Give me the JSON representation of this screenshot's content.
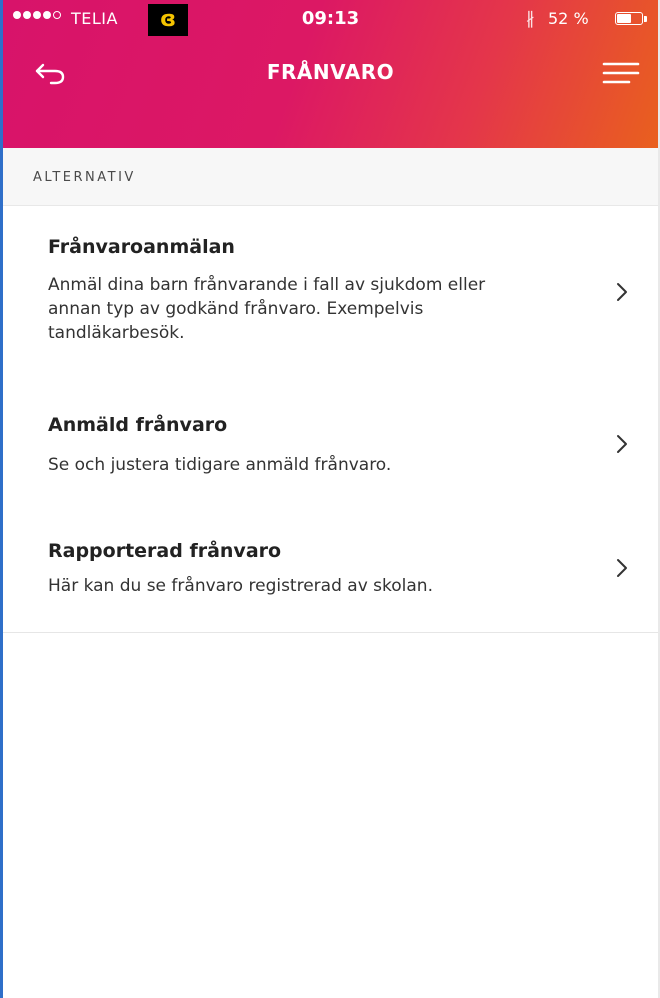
{
  "status_bar": {
    "carrier": "TELIA",
    "time": "09:13",
    "battery": "52 %",
    "battery_level": 0.52
  },
  "nav": {
    "title": "FRÅNVARO",
    "back_icon": "back-arrow-icon",
    "menu_icon": "hamburger-menu-icon"
  },
  "section": {
    "label": "ALTERNATIV"
  },
  "items": [
    {
      "title": "Frånvaroanmälan",
      "description": "Anmäl dina barn frånvarande i fall av sjukdom eller annan typ av godkänd frånvaro. Exempelvis tandläkarbesök."
    },
    {
      "title": "Anmäld frånvaro",
      "description": "Se och justera tidigare anmäld frånvaro."
    },
    {
      "title": "Rapporterad frånvaro",
      "description": "Här kan du se frånvaro registrerad av skolan."
    }
  ],
  "colors": {
    "header_gradient_start": "#d8136a",
    "header_gradient_end": "#e9601e",
    "app_badge_bg": "#000000",
    "app_badge_fg": "#f5c400"
  }
}
